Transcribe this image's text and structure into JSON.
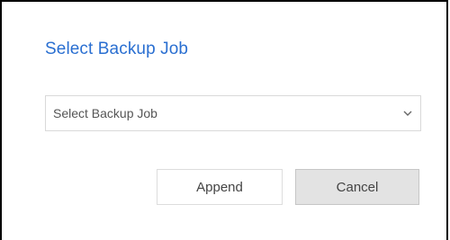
{
  "dialog": {
    "title": "Select Backup Job",
    "select": {
      "selected_value": "Select Backup Job",
      "chevron_icon": "chevron-down-icon"
    },
    "buttons": {
      "append_label": "Append",
      "cancel_label": "Cancel"
    }
  },
  "colors": {
    "title": "#2a6fd1",
    "cancel_background": "#e3e3e3",
    "border": "#d9d9d9"
  }
}
